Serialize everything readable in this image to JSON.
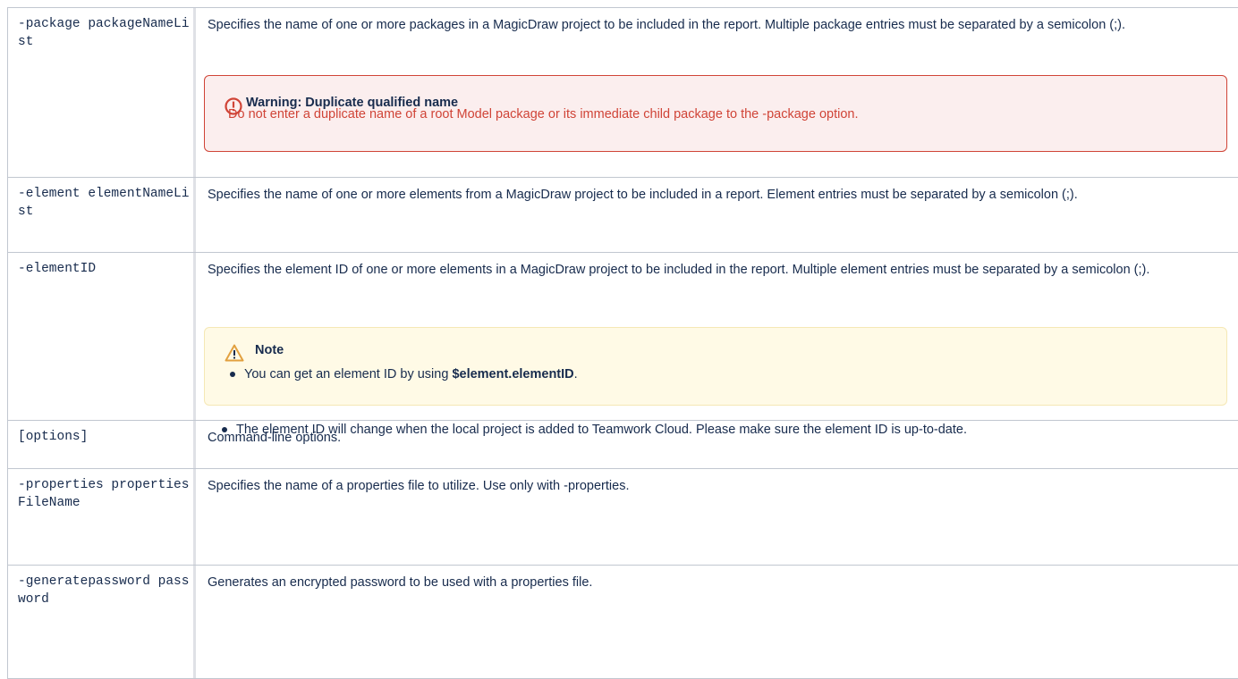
{
  "rows": [
    {
      "option": "-package packageNameList",
      "description": "Specifies the name of one or more packages in a MagicDraw project to be included in the report. Multiple package entries must be separated by a semicolon (;)."
    },
    {
      "option": "-element elementNameList",
      "description": "Specifies the name of one or more elements from a MagicDraw project to be included in a report. Element entries must be separated by a semicolon (;)."
    },
    {
      "option": "-elementID",
      "description": "Specifies the element ID of one or more elements in a MagicDraw project to be included in the report. Multiple element entries must be separated by a semicolon (;)."
    },
    {
      "option": "[options]",
      "description": "Command-line options."
    },
    {
      "option": "-properties propertiesFileName",
      "description": "Specifies the name of a properties file to utilize. Use only with -properties."
    },
    {
      "option": "-generatepassword password",
      "description": "Generates an encrypted password to be used with a properties file."
    }
  ],
  "warning": {
    "title": "Warning: Duplicate qualified name",
    "body": "Do not enter a duplicate name of a root Model package or its immediate child package to the -package option.",
    "icon": "warning-circle-icon"
  },
  "note": {
    "title": "Note",
    "icon": "warning-triangle-icon",
    "bullet1_prefix": "You can get an element ID by using ",
    "bullet1_code": "$element.elementID",
    "bullet1_suffix": ".",
    "bullet2": "The element ID will change when the local project is added to Teamwork Cloud. Please make sure the element ID is up-to-date."
  },
  "colors": {
    "border": "#c1c7d0",
    "text": "#172b4d",
    "warning_border": "#d04437",
    "warning_bg": "#fbeeee",
    "note_bg": "#fffae6",
    "note_border": "#f5e8b5"
  }
}
